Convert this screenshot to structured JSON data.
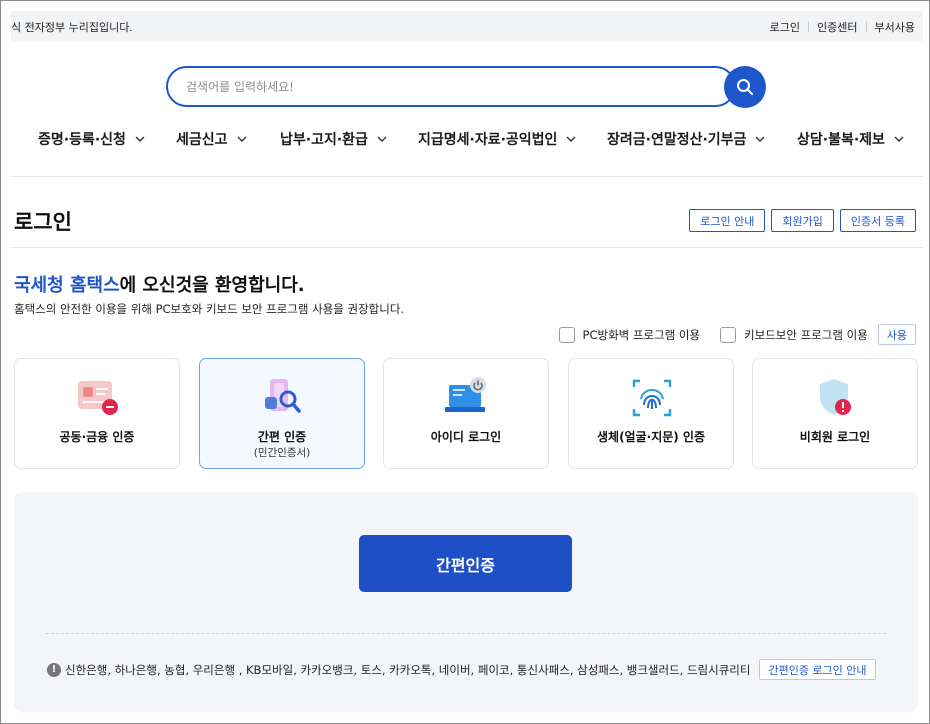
{
  "topbar": {
    "gov_notice": "식 전자정부 누리집입니다.",
    "links": [
      "로그인",
      "인증센터",
      "부서사용"
    ]
  },
  "search": {
    "placeholder": "검색어를 입력하세요!",
    "icon": "search-icon"
  },
  "gnb": {
    "items": [
      "증명·등록·신청",
      "세금신고",
      "납부·고지·환급",
      "지급명세·자료·공익법인",
      "장려금·연말정산·기부금",
      "상담·불복·제보"
    ]
  },
  "page": {
    "title": "로그인",
    "buttons": [
      "로그인 안내",
      "회원가입",
      "인증서 등록"
    ]
  },
  "welcome": {
    "brand": "국세청 홈택스",
    "rest": "에 오신것을 환영합니다.",
    "sub": "홈택스의 안전한 이용을 위해 PC보호와 키보드 보안 프로그램 사용을 권장합니다."
  },
  "options": {
    "pc_firewall": "PC방화벽 프로그램 이용",
    "keyboard_security": "키보드보안 프로그램 이용",
    "use_button": "사용"
  },
  "methods": [
    {
      "label": "공동·금융 인증",
      "sub": "",
      "icon": "certificate-card-icon",
      "selected": false
    },
    {
      "label": "간편 인증",
      "sub": "(민간인증서)",
      "icon": "simple-auth-search-icon",
      "selected": true
    },
    {
      "label": "아이디 로그인",
      "sub": "",
      "icon": "laptop-power-icon",
      "selected": false
    },
    {
      "label": "생체(얼굴·지문) 인증",
      "sub": "",
      "icon": "fingerprint-icon",
      "selected": false
    },
    {
      "label": "비회원 로그인",
      "sub": "",
      "icon": "shield-alert-icon",
      "selected": false
    }
  ],
  "panel": {
    "main_button": "간편인증",
    "providers": "신한은행, 하나은행, 농협, 우리은행 , KB모바일, 카카오뱅크, 토스, 카카오톡, 네이버, 페이코, 통신사패스, 삼성패스, 뱅크샐러드, 드림시큐리티",
    "guide_button": "간편인증 로그인 안내"
  },
  "colors": {
    "primary": "#1f56c9",
    "panel_bg": "#f3f5f9",
    "selected_border": "#6aa2e8"
  }
}
